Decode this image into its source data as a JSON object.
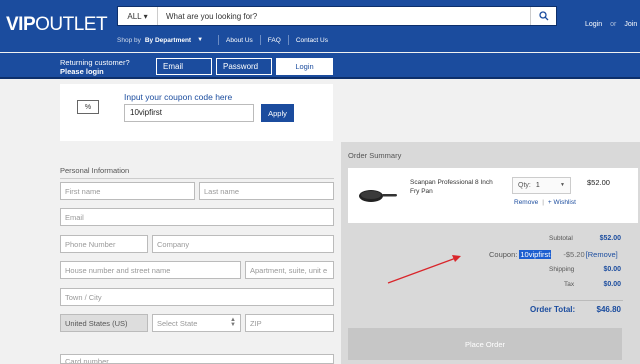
{
  "header": {
    "logo_bold": "VIP",
    "logo_rest": "OUTLET",
    "search_category": "ALL",
    "search_placeholder": "What are you looking for?",
    "shop_by": "Shop by",
    "department": "By Department",
    "nav": [
      "About Us",
      "FAQ",
      "Contact Us"
    ],
    "login": "Login",
    "or": "or",
    "join": "Join"
  },
  "login_bar": {
    "returning": "Returning customer?",
    "please_login": "Please login",
    "email_label": "Email",
    "password_label": "Password",
    "login_button": "Login"
  },
  "coupon": {
    "title": "Input your coupon code here",
    "value": "10vipfirst",
    "apply": "Apply",
    "ticket_glyph": "%"
  },
  "personal": {
    "title": "Personal Information",
    "first_name": "First name",
    "last_name": "Last name",
    "email": "Email",
    "phone": "Phone Number",
    "company": "Company",
    "address1": "House number and street name",
    "address2": "Apartment, suite, unit e",
    "city": "Town / City",
    "country": "United States (US)",
    "state": "Select State",
    "zip": "ZIP",
    "card": "Card number"
  },
  "summary": {
    "title": "Order Summary",
    "item": {
      "name": "Scanpan Professional 8 Inch Fry Pan",
      "qty_label": "Qty:",
      "qty": "1",
      "price": "$52.00",
      "remove": "Remove",
      "sep": "|",
      "wishlist": "+ Wishlist"
    },
    "subtotal_label": "Subtotal",
    "subtotal": "$52.00",
    "coupon_label": "Coupon:",
    "coupon_code": "10vipfirst",
    "coupon_amount": "-$5.20",
    "coupon_remove": "[Remove]",
    "shipping_label": "Shipping",
    "shipping": "$0.00",
    "tax_label": "Tax",
    "tax": "$0.00",
    "total_label": "Order Total:",
    "total": "$46.80",
    "place_order": "Place Order"
  },
  "colors": {
    "brand_blue": "#1b4c9e",
    "annotation_arrow": "#d9262b"
  }
}
